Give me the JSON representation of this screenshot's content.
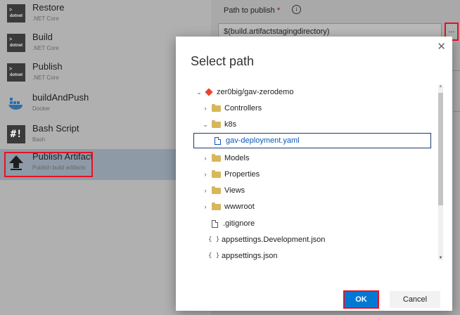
{
  "tasks": [
    {
      "title": "Restore",
      "subtitle": ".NET Core",
      "icon": "dotnet-icon"
    },
    {
      "title": "Build",
      "subtitle": ".NET Core",
      "icon": "dotnet-icon"
    },
    {
      "title": "Publish",
      "subtitle": ".NET Core",
      "icon": "dotnet-icon"
    },
    {
      "title": "buildAndPush",
      "subtitle": "Docker",
      "icon": "docker-icon"
    },
    {
      "title": "Bash Script",
      "subtitle": "Bash",
      "icon": "bash-icon"
    },
    {
      "title": "Publish Artifact",
      "subtitle": "Publish build artifacts",
      "icon": "upload-arrow-icon"
    }
  ],
  "icon_text": {
    "dotnet": "dotnet",
    "dotnet_chevron": ">",
    "bash": "#!"
  },
  "details": {
    "path_label": "Path to publish",
    "required_mark": "*",
    "info_glyph": "i",
    "path_value": "$(build.artifactstagingdirectory)",
    "browse_label": "..."
  },
  "dialog": {
    "title": "Select path",
    "close_glyph": "✕",
    "ok_label": "OK",
    "cancel_label": "Cancel",
    "tree": {
      "repo": "zer0big/gav-zerodemo",
      "controllers": "Controllers",
      "k8s": "k8s",
      "deployment": "gav-deployment.yaml",
      "models": "Models",
      "properties": "Properties",
      "views": "Views",
      "wwwroot": "wwwroot",
      "gitignore": ".gitignore",
      "appsettings_dev": "appsettings.Development.json",
      "appsettings": "appsettings.json"
    },
    "glyphs": {
      "expanded": "⌄",
      "collapsed": "›",
      "json": "{ }",
      "scroll_up": "▲",
      "scroll_down": "▼"
    }
  },
  "colors": {
    "accent": "#0078d4",
    "highlight": "#e81123",
    "folder": "#d6b75c",
    "repo": "#e8462a"
  }
}
